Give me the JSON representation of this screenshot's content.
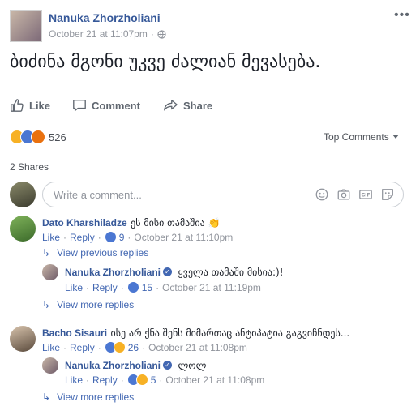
{
  "post": {
    "author": "Nanuka Zhorzholiani",
    "timestamp": "October 21 at 11:07pm",
    "privacy_dot": "·",
    "more_label": "•••",
    "text": "ბიძინა მგონი უკვე ძალიან მევასება."
  },
  "actions": {
    "like": "Like",
    "comment": "Comment",
    "share": "Share"
  },
  "reactions": {
    "icons": [
      "haha-icon",
      "like-icon",
      "angry-icon"
    ],
    "count": "526",
    "sort_label": "Top Comments"
  },
  "shares": "2 Shares",
  "comment_input": {
    "placeholder": "Write a comment..."
  },
  "comments": [
    {
      "author": "Dato Kharshiladze",
      "text": "ეს მისი თამაშია 👏",
      "like": "Like",
      "reply": "Reply",
      "reaction_count": "9",
      "time": "October 21 at 11:10pm",
      "view_previous": "View previous replies",
      "reply_item": {
        "author": "Nanuka Zhorzholiani",
        "text": "ყველა თამაში მისია:)!",
        "like": "Like",
        "reply": "Reply",
        "reaction_count": "15",
        "time": "October 21 at 11:19pm"
      },
      "view_more": "View more replies"
    },
    {
      "author": "Bacho Sisauri",
      "text": "ისე არ ქნა შენს მიმართაც ანტიპატია გაგვიჩნდეს...",
      "like": "Like",
      "reply": "Reply",
      "reaction_count": "26",
      "time": "October 21 at 11:08pm",
      "reply_item": {
        "author": "Nanuka Zhorzholiani",
        "text": "ლოლ",
        "like": "Like",
        "reply": "Reply",
        "reaction_count": "5",
        "time": "October 21 at 11:08pm"
      },
      "view_more": "View more replies"
    }
  ],
  "colors": {
    "link": "#365899",
    "action_blue": "#4267b2",
    "muted": "#90949c",
    "like_blue": "#4b77d2",
    "haha_yellow": "#f7b125",
    "angry_orange": "#e9710f"
  }
}
